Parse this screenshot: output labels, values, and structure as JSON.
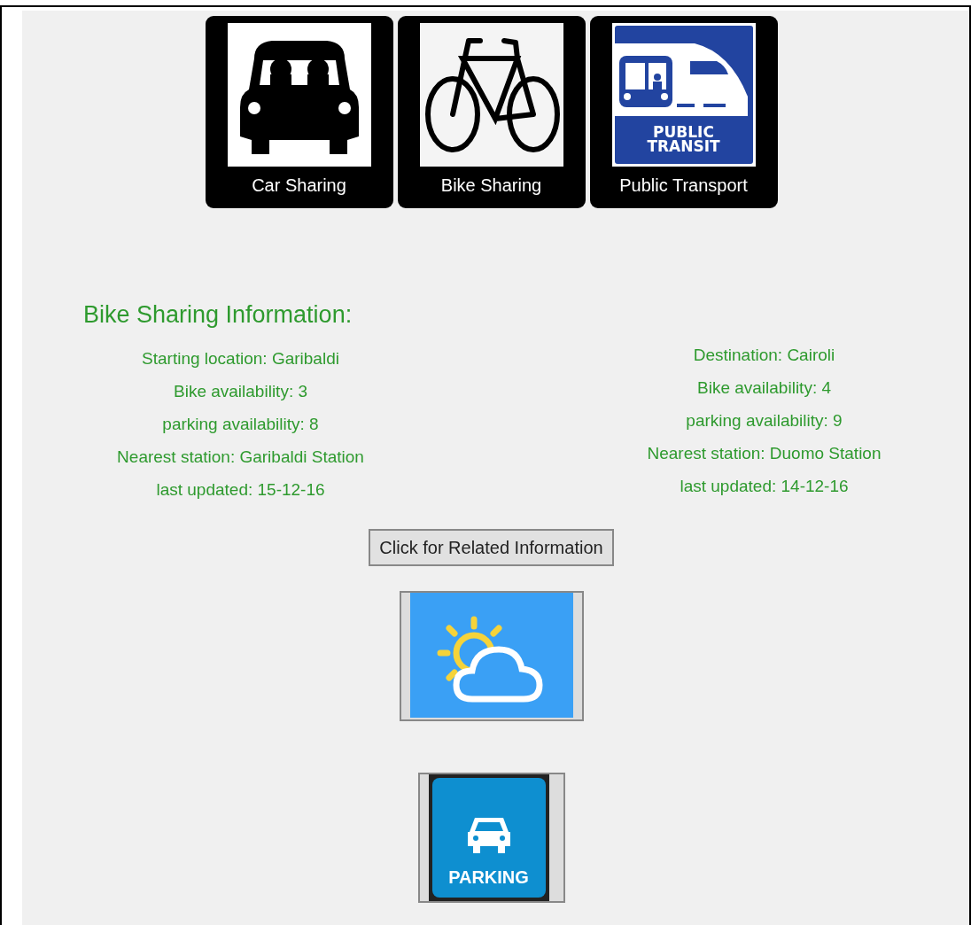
{
  "modes": [
    {
      "kind": "car",
      "label": "Car Sharing"
    },
    {
      "kind": "bike",
      "label": "Bike Sharing"
    },
    {
      "kind": "transit",
      "label": "Public Transport",
      "sign_text": [
        "PUBLIC",
        "TRANSIT"
      ]
    }
  ],
  "info": {
    "title": "Bike Sharing Information:",
    "start": [
      "Starting location: Garibaldi",
      "Bike availability: 3",
      "parking availability: 8",
      "Nearest station: Garibaldi Station",
      "last updated: 15-12-16"
    ],
    "destination": [
      "Destination: Cairoli",
      "Bike availability: 4",
      "parking availability: 9",
      "Nearest station: Duomo Station",
      "last updated: 14-12-16"
    ]
  },
  "related_button": "Click for Related Information",
  "links": [
    {
      "kind": "weather"
    },
    {
      "kind": "parking",
      "caption": "PARKING"
    }
  ]
}
